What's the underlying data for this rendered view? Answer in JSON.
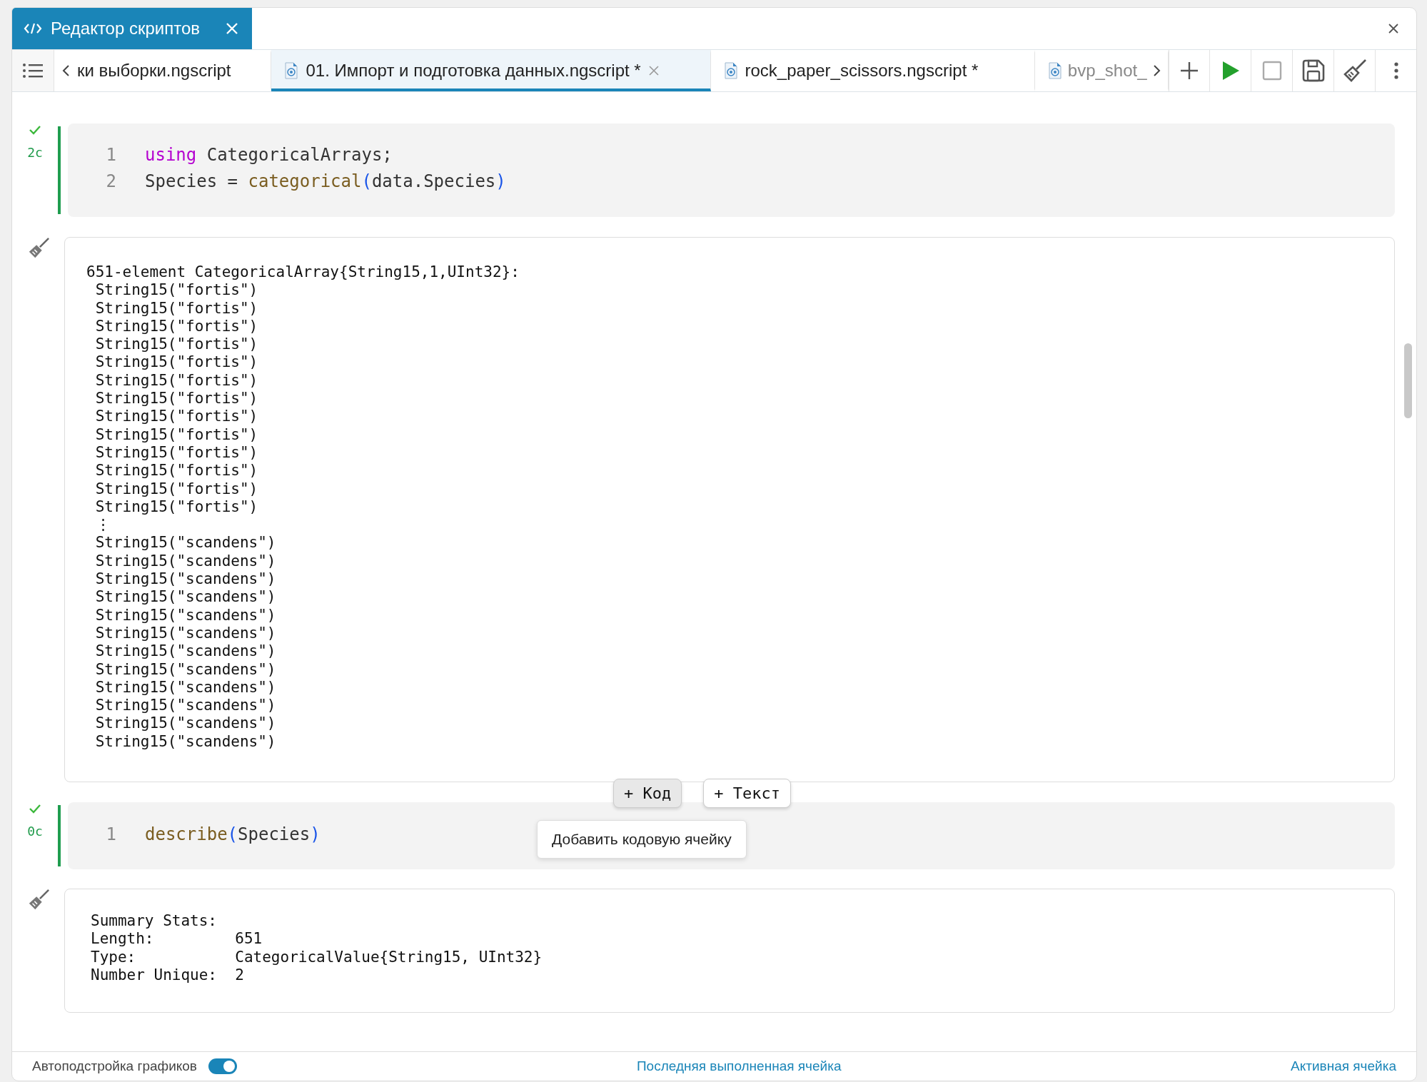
{
  "panel": {
    "title": "Редактор скриптов"
  },
  "tabs": [
    {
      "label": "ки выборки.ngscript",
      "selected": false,
      "clipped_start": true,
      "clipped_end": false
    },
    {
      "label": "01. Импорт и подготовка данных.ngscript *",
      "selected": true,
      "clipped_start": false,
      "clipped_end": false
    },
    {
      "label": "rock_paper_scissors.ngscript *",
      "selected": false,
      "clipped_start": false,
      "clipped_end": false
    },
    {
      "label": "bvp_shot_",
      "selected": false,
      "clipped_start": false,
      "clipped_end": true
    }
  ],
  "cells": [
    {
      "kind": "code",
      "done": true,
      "time": "2c",
      "lines": [
        {
          "number": "1",
          "tokens": [
            {
              "text": "using",
              "kind": "keyword"
            },
            {
              "text": " CategoricalArrays;",
              "kind": "plain"
            }
          ]
        },
        {
          "number": "2",
          "tokens": [
            {
              "text": "Species = ",
              "kind": "plain"
            },
            {
              "text": "categorical",
              "kind": "function"
            },
            {
              "text": "(",
              "kind": "paren"
            },
            {
              "text": "data.Species",
              "kind": "plain"
            },
            {
              "text": ")",
              "kind": "paren"
            }
          ]
        }
      ]
    },
    {
      "kind": "output",
      "lines": [
        "651-element CategoricalArray{String15,1,UInt32}:",
        " String15(\"fortis\")",
        " String15(\"fortis\")",
        " String15(\"fortis\")",
        " String15(\"fortis\")",
        " String15(\"fortis\")",
        " String15(\"fortis\")",
        " String15(\"fortis\")",
        " String15(\"fortis\")",
        " String15(\"fortis\")",
        " String15(\"fortis\")",
        " String15(\"fortis\")",
        " String15(\"fortis\")",
        " String15(\"fortis\")",
        " ⋮",
        " String15(\"scandens\")",
        " String15(\"scandens\")",
        " String15(\"scandens\")",
        " String15(\"scandens\")",
        " String15(\"scandens\")",
        " String15(\"scandens\")",
        " String15(\"scandens\")",
        " String15(\"scandens\")",
        " String15(\"scandens\")",
        " String15(\"scandens\")",
        " String15(\"scandens\")",
        " String15(\"scandens\")"
      ]
    },
    {
      "kind": "code",
      "done": true,
      "time": "0c",
      "lines": [
        {
          "number": "1",
          "tokens": [
            {
              "text": "describe",
              "kind": "function"
            },
            {
              "text": "(",
              "kind": "paren"
            },
            {
              "text": "Species",
              "kind": "plain"
            },
            {
              "text": ")",
              "kind": "paren"
            }
          ]
        }
      ]
    },
    {
      "kind": "output",
      "lines": [
        "Summary Stats:",
        "Length:         651",
        "Type:           CategoricalValue{String15, UInt32}",
        "Number Unique:  2"
      ]
    }
  ],
  "insert_buttons": [
    "+ Код",
    "+ Текст"
  ],
  "tooltip": "Добавить кодовую ячейку",
  "status_bar": {
    "toggle": {
      "label": "Автоподстройка графиков",
      "on": true
    },
    "links": [
      "Последняя выполненная ячейка",
      "Активная ячейка"
    ]
  }
}
